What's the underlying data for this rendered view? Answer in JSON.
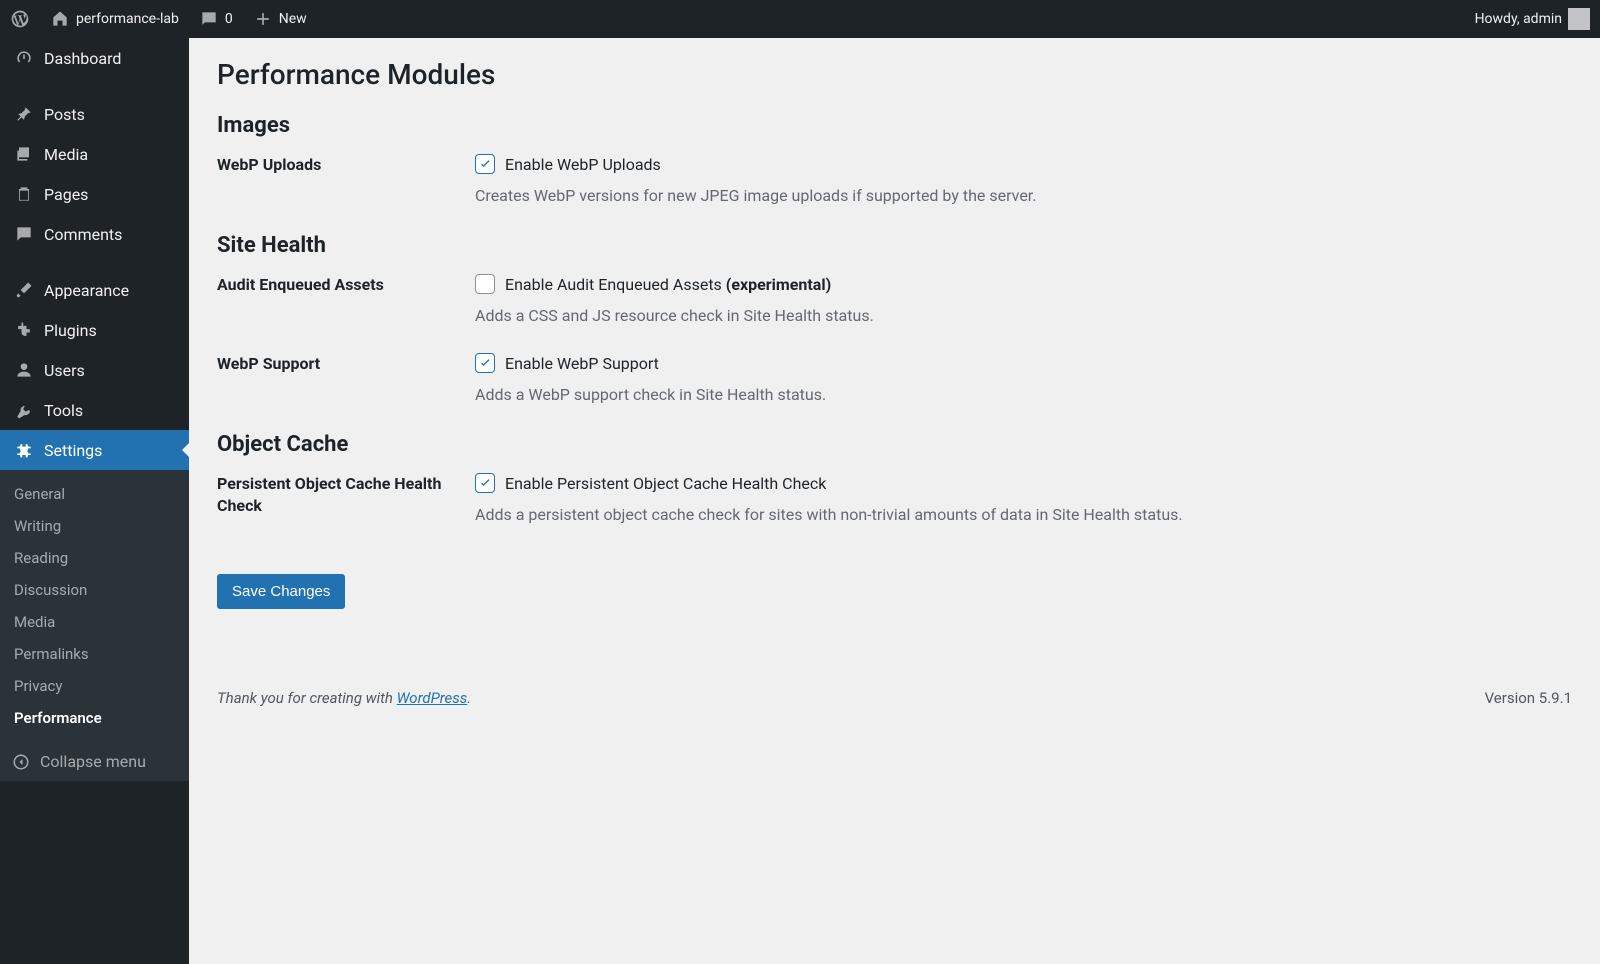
{
  "adminbar": {
    "site_name": "performance-lab",
    "comments_count": "0",
    "new_label": "New",
    "howdy": "Howdy, admin"
  },
  "sidebar": {
    "items": [
      {
        "label": "Dashboard"
      },
      {
        "label": "Posts"
      },
      {
        "label": "Media"
      },
      {
        "label": "Pages"
      },
      {
        "label": "Comments"
      },
      {
        "label": "Appearance"
      },
      {
        "label": "Plugins"
      },
      {
        "label": "Users"
      },
      {
        "label": "Tools"
      },
      {
        "label": "Settings"
      }
    ],
    "submenu": [
      {
        "label": "General"
      },
      {
        "label": "Writing"
      },
      {
        "label": "Reading"
      },
      {
        "label": "Discussion"
      },
      {
        "label": "Media"
      },
      {
        "label": "Permalinks"
      },
      {
        "label": "Privacy"
      },
      {
        "label": "Performance"
      }
    ],
    "collapse": "Collapse menu"
  },
  "page": {
    "heading": "Performance Modules",
    "sections": [
      {
        "title": "Images",
        "rows": [
          {
            "label": "WebP Uploads",
            "checkbox_label": "Enable WebP Uploads",
            "experimental": "",
            "checked": true,
            "desc": "Creates WebP versions for new JPEG image uploads if supported by the server."
          }
        ]
      },
      {
        "title": "Site Health",
        "rows": [
          {
            "label": "Audit Enqueued Assets",
            "checkbox_label": "Enable Audit Enqueued Assets ",
            "experimental": "(experimental)",
            "checked": false,
            "desc": "Adds a CSS and JS resource check in Site Health status."
          },
          {
            "label": "WebP Support",
            "checkbox_label": "Enable WebP Support",
            "experimental": "",
            "checked": true,
            "desc": "Adds a WebP support check in Site Health status."
          }
        ]
      },
      {
        "title": "Object Cache",
        "rows": [
          {
            "label": "Persistent Object Cache Health Check",
            "checkbox_label": "Enable Persistent Object Cache Health Check",
            "experimental": "",
            "checked": true,
            "desc": "Adds a persistent object cache check for sites with non-trivial amounts of data in Site Health status."
          }
        ]
      }
    ],
    "save_button": "Save Changes",
    "footer_thanks": "Thank you for creating with ",
    "footer_link": "WordPress",
    "footer_period": ".",
    "version": "Version 5.9.1"
  }
}
